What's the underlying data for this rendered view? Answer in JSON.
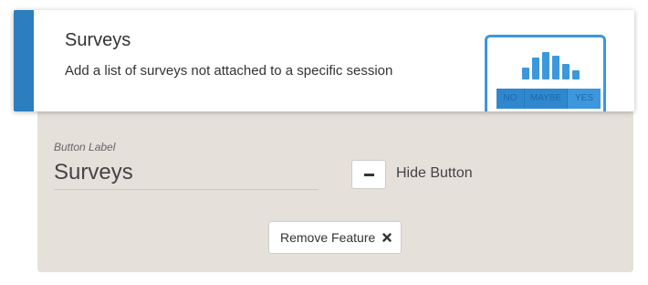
{
  "feature": {
    "title": "Surveys",
    "description": "Add a list of surveys not attached to a specific session",
    "icon": {
      "name": "survey-icon",
      "options": [
        "NO",
        "MAYBE",
        "YES"
      ],
      "border_color": "#3d97dc"
    },
    "accent_color": "#2c7ebf"
  },
  "settings": {
    "button_label_caption": "Button Label",
    "button_label_value": "Surveys",
    "hide_button_label": "Hide Button",
    "remove_feature_label": "Remove Feature",
    "panel_color": "#e6e0db"
  }
}
